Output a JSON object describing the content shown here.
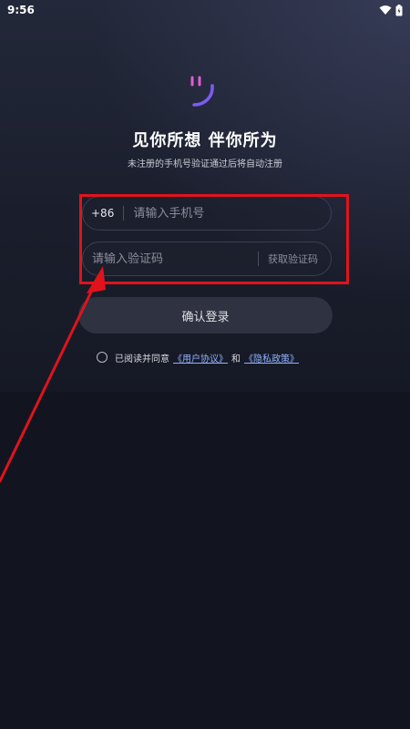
{
  "status_bar": {
    "time": "9:56",
    "wifi_icon": "wifi-icon",
    "battery_icon": "battery-icon"
  },
  "logo": {
    "icon": "smile-logo-icon",
    "colors": {
      "eyes": "#e25cd8",
      "mouth": "#7a5cf0"
    }
  },
  "header": {
    "title": "见你所想 伴你所为",
    "subtitle": "未注册的手机号验证通过后将自动注册"
  },
  "phone_field": {
    "prefix": "+86",
    "placeholder": "请输入手机号"
  },
  "code_field": {
    "placeholder": "请输入验证码",
    "get_code_label": "获取验证码"
  },
  "login_button": {
    "label": "确认登录"
  },
  "agreement": {
    "prefix": "已阅读并同意",
    "user_agreement": "《用户协议》",
    "conjunction": "和",
    "privacy_policy": "《隐私政策》"
  },
  "annotation": {
    "color": "#e0131b"
  }
}
